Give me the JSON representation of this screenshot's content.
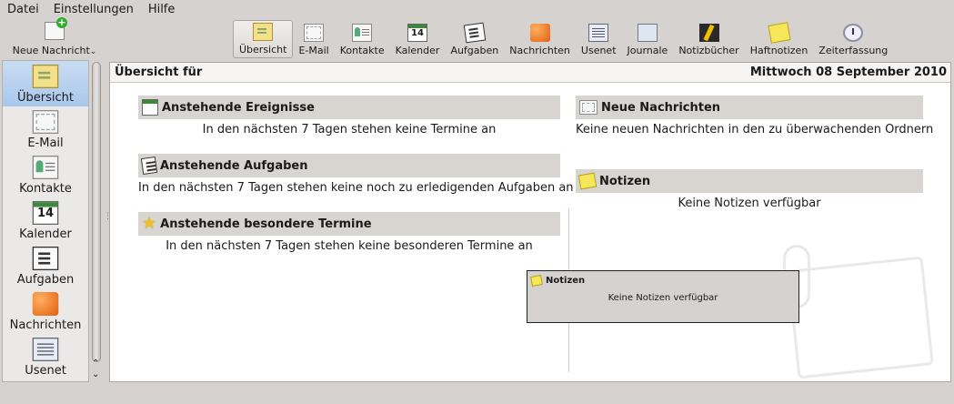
{
  "menu": [
    "Datei",
    "Einstellungen",
    "Hilfe"
  ],
  "new_message": {
    "label": "Neue Nachricht",
    "icon": "new-message-icon"
  },
  "toolbar": [
    {
      "label": "Übersicht",
      "icon": "summary-icon",
      "active": true
    },
    {
      "label": "E-Mail",
      "icon": "mail-icon"
    },
    {
      "label": "Kontakte",
      "icon": "contacts-icon"
    },
    {
      "label": "Kalender",
      "icon": "calendar-icon",
      "badge": "14"
    },
    {
      "label": "Aufgaben",
      "icon": "tasks-icon"
    },
    {
      "label": "Nachrichten",
      "icon": "feeds-icon"
    },
    {
      "label": "Usenet",
      "icon": "usenet-icon"
    },
    {
      "label": "Journale",
      "icon": "journal-icon"
    },
    {
      "label": "Notizbücher",
      "icon": "notebooks-icon"
    },
    {
      "label": "Haftnotizen",
      "icon": "sticky-notes-icon"
    },
    {
      "label": "Zeiterfassung",
      "icon": "time-tracker-icon"
    }
  ],
  "sidebar": [
    {
      "label": "Übersicht",
      "active": true
    },
    {
      "label": "E-Mail"
    },
    {
      "label": "Kontakte"
    },
    {
      "label": "Kalender",
      "badge": "14"
    },
    {
      "label": "Aufgaben"
    },
    {
      "label": "Nachrichten"
    },
    {
      "label": "Usenet"
    }
  ],
  "header": {
    "title": "Übersicht für",
    "date": "Mittwoch 08 September 2010"
  },
  "sections": {
    "events": {
      "title": "Anstehende Ereignisse",
      "body": "In den nächsten 7 Tagen stehen keine Termine an"
    },
    "todos": {
      "title": "Anstehende Aufgaben",
      "body": "In den nächsten 7 Tagen stehen keine noch zu erledigenden Aufgaben an"
    },
    "special": {
      "title": "Anstehende besondere Termine",
      "body": "In den nächsten 7 Tagen stehen keine besonderen Termine an"
    },
    "mail": {
      "title": "Neue Nachrichten",
      "body": "Keine neuen Nachrichten in den zu überwachenden Ordnern"
    },
    "notes": {
      "title": "Notizen",
      "body": "Keine Notizen verfügbar"
    }
  },
  "tooltip": {
    "title": "Notizen",
    "body": "Keine Notizen verfügbar"
  }
}
